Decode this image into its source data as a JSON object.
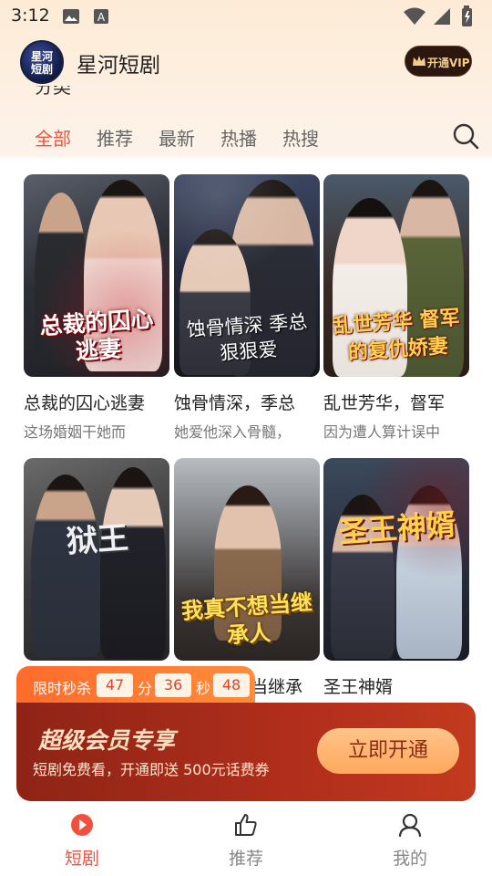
{
  "status_bar": {
    "time": "3:12"
  },
  "header": {
    "app_logo_text_line1": "星河",
    "app_logo_text_line2": "短剧",
    "app_name": "星河短剧",
    "vip_label": "开通VIP"
  },
  "section": {
    "title_partial": "分类"
  },
  "tabs": [
    {
      "label": "全部",
      "active": true
    },
    {
      "label": "推荐",
      "active": false
    },
    {
      "label": "最新",
      "active": false
    },
    {
      "label": "热播",
      "active": false
    },
    {
      "label": "热搜",
      "active": false
    }
  ],
  "dramas": [
    {
      "name": "总裁的囚心逃妻",
      "desc": "这场婚姻干她而",
      "poster_title": "总裁的囚心逃妻"
    },
    {
      "name": "蚀骨情深，季总",
      "desc": "她爱他深入骨髓，",
      "poster_title": "蚀骨情深 季总狠狠爱"
    },
    {
      "name": "乱世芳华，督军",
      "desc": "因为遭人算计误中",
      "poster_title": "乱世芳华 督军的复仇娇妻"
    },
    {
      "name": "",
      "desc": "",
      "poster_title": "狱王"
    },
    {
      "name": "当继承",
      "desc": "",
      "poster_title": "我真不想当继承人"
    },
    {
      "name": "圣王神婿",
      "desc": "",
      "poster_title": "圣王神婿"
    }
  ],
  "promo": {
    "countdown_label": "限时秒杀",
    "countdown": {
      "minutes": "47",
      "seconds": "36",
      "millis": "48",
      "unit_min": "分",
      "unit_sec": "秒"
    },
    "headline": "超级会员专享",
    "subtitle": "短剧免费看，开通即送 500元话费券",
    "cta": "立即开通"
  },
  "bottom_nav": [
    {
      "label": "短剧",
      "icon": "play-icon",
      "active": true
    },
    {
      "label": "推荐",
      "icon": "thumbs-up-icon",
      "active": false
    },
    {
      "label": "我的",
      "icon": "user-icon",
      "active": false
    }
  ],
  "colors": {
    "accent": "#f2503c",
    "promo": "#b12e1b",
    "cta": "#ffb06e"
  }
}
